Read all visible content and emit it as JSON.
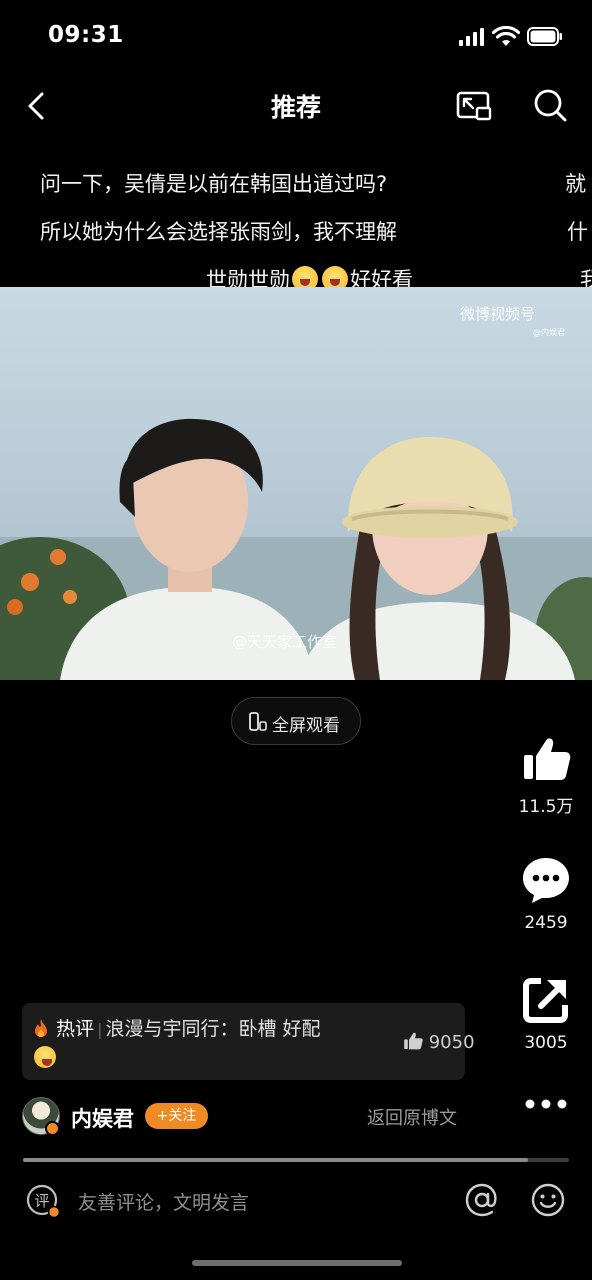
{
  "status_bar": {
    "time": "09:31"
  },
  "header": {
    "title": "推荐"
  },
  "danmaku": [
    "问一下，吴倩是以前在韩国出道过吗?",
    "所以她为什么会选择张雨剑，我不理解",
    "世勋世勋",
    "好好看",
    "就",
    "什",
    "我"
  ],
  "video": {
    "watermark": "微博视频号",
    "watermark_sub": "@内娱君",
    "studio_mark": "@天天家工作室",
    "fullscreen_label": "全屏观看"
  },
  "actions": {
    "likes": "11.5万",
    "comments": "2459",
    "shares": "3005"
  },
  "hot_comment": {
    "tag": "热评",
    "text": "浪漫与宇同行：卧槽 好配",
    "likes": "9050"
  },
  "author": {
    "name": "内娱君",
    "follow_label": "+关注",
    "back_label": "返回原博文"
  },
  "progress": {
    "fraction": 0.925
  },
  "bottom_bar": {
    "comment_placeholder": "友善评论，文明发言"
  },
  "colors": {
    "accent": "#f08a24",
    "background": "#000000"
  }
}
